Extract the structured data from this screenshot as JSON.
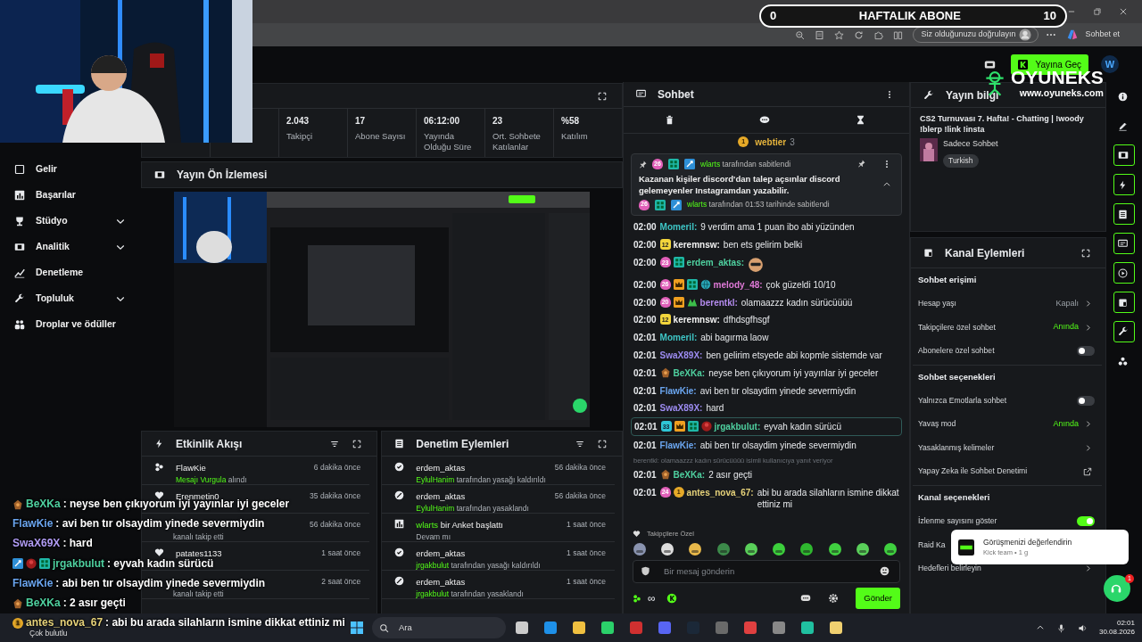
{
  "browser": {
    "verify_label": "Siz olduğunuzu doğrulayın",
    "copilot_label": "Sohbet et"
  },
  "goal_overlay": {
    "start": "0",
    "title": "HAFTALIK ABONE",
    "target": "10",
    "level": 0
  },
  "header": {
    "go_live": "Yayına Geç",
    "avatar": "W"
  },
  "logo_overlay": {
    "name": "OYUNEKS",
    "url": "www.oyuneks.com"
  },
  "sidebar": {
    "items": [
      {
        "label": "Gelir",
        "expandable": false
      },
      {
        "label": "Başarılar",
        "expandable": false
      },
      {
        "label": "Stüdyo",
        "expandable": true
      },
      {
        "label": "Analitik",
        "expandable": true
      },
      {
        "label": "Denetleme",
        "expandable": false
      },
      {
        "label": "Topluluk",
        "expandable": true
      },
      {
        "label": "Droplar ve ödüller",
        "expandable": false
      }
    ]
  },
  "stats": [
    {
      "value": "2.043",
      "label": "Takipçi"
    },
    {
      "value": "17",
      "label": "Abone Sayısı"
    },
    {
      "value": "06:12:00",
      "label": "Yayında Olduğu Süre"
    },
    {
      "value": "23",
      "label": "Ort. Sohbete Katılanlar"
    },
    {
      "value": "%58",
      "label": "Katılım"
    }
  ],
  "preview": {
    "title": "Yayın Ön İzlemesi"
  },
  "activity": {
    "title": "Etkinlik Akışı",
    "items": [
      {
        "kind": "highlight",
        "user": "FlawKie",
        "highlight": "Mesajı Vurgula",
        "detail": "alındı",
        "time": "6 dakika önce"
      },
      {
        "kind": "follow",
        "user": "Erenmetin0",
        "time": "35 dakika önce"
      },
      {
        "detail": "kanalı takip etti",
        "time": "56 dakika önce"
      },
      {
        "kind": "follow",
        "user": "patates1133",
        "time": "1 saat önce"
      },
      {
        "detail": "kanalı takip etti",
        "time": "2 saat önce"
      }
    ]
  },
  "moderation": {
    "title": "Denetim Eylemleri",
    "items": [
      {
        "kind": "unban",
        "user": "erdem_aktas",
        "actor": "EylulHanim",
        "detail": "tarafından yasağı kaldırıldı",
        "time": "56 dakika önce"
      },
      {
        "kind": "ban",
        "user": "erdem_aktas",
        "actor": "EylulHanim",
        "detail": "tarafından yasaklandı",
        "time": "56 dakika önce"
      },
      {
        "kind": "poll",
        "actor": "wlarts",
        "action": "bir Anket başlattı",
        "detail": "Devam mı",
        "time": "1 saat önce"
      },
      {
        "kind": "unban",
        "user": "erdem_aktas",
        "actor": "jrgakbulut",
        "detail": "tarafından yasağı kaldırıldı",
        "time": "1 saat önce"
      },
      {
        "kind": "ban",
        "user": "erdem_aktas",
        "actor": "jrgakbulut",
        "detail": "tarafından yasaklandı",
        "time": "1 saat önce"
      }
    ]
  },
  "chat": {
    "title": "Sohbet",
    "gift_banner": {
      "coin": "1",
      "user": "webtier",
      "count": "3"
    },
    "pinned": {
      "badges": [
        {
          "kind": "sub",
          "label": "26"
        },
        {
          "kind": "og"
        },
        {
          "kind": "mod"
        }
      ],
      "user": "wlarts",
      "header": "tarafından sabitlendi",
      "text": "Kazanan kişiler discord'dan talep açsınlar discord gelemeyenler Instagramdan yazabilir.",
      "footer_badges": [
        {
          "kind": "sub",
          "label": "26"
        },
        {
          "kind": "og"
        },
        {
          "kind": "mod"
        }
      ],
      "footer_user": "wlarts",
      "footer": "tarafından 01:53 tarihinde sabitlendi"
    },
    "messages": [
      {
        "kind": "message",
        "time": "02:00",
        "user": "Momeril:",
        "color": "#3ec6c6",
        "text": "9 verdim ama 1 puan ibo abi yüzünden",
        "highlighted": false
      },
      {
        "kind": "message",
        "time": "02:00",
        "badges": [
          {
            "kind": "sub-gold",
            "label": "12"
          }
        ],
        "user": "keremnsw:",
        "color": "#f2f2f2",
        "text": "ben ets gelirim belki",
        "highlighted": false
      },
      {
        "kind": "message",
        "time": "02:00",
        "badges": [
          {
            "kind": "sub",
            "label": "23"
          },
          {
            "kind": "og"
          }
        ],
        "user": "erdem_aktas:",
        "color": "#4fd1a0",
        "emote": true,
        "highlighted": false
      },
      {
        "kind": "message",
        "time": "02:00",
        "badges": [
          {
            "kind": "sub",
            "label": "26"
          },
          {
            "kind": "crown"
          },
          {
            "kind": "og"
          },
          {
            "kind": "globe"
          }
        ],
        "user": "melody_48:",
        "color": "#e07ad8",
        "text": "çok güzeldi 10/10",
        "highlighted": false
      },
      {
        "kind": "message",
        "time": "02:00",
        "badges": [
          {
            "kind": "sub",
            "label": "20"
          },
          {
            "kind": "crown"
          },
          {
            "kind": "m-logo"
          }
        ],
        "user": "berentkl:",
        "color": "#b58cf0",
        "text": "olamaazzz kadın sürücüüüü",
        "highlighted": false
      },
      {
        "kind": "message",
        "time": "02:00",
        "badges": [
          {
            "kind": "sub-gold",
            "label": "12"
          }
        ],
        "user": "keremnsw:",
        "color": "#f2f2f2",
        "text": "dfhdsgfhsgf",
        "highlighted": false
      },
      {
        "kind": "message",
        "time": "02:01",
        "user": "Momeril:",
        "color": "#3ec6c6",
        "text": "abi bagırma laow",
        "highlighted": false
      },
      {
        "kind": "message",
        "time": "02:01",
        "user": "SwaX89X:",
        "color": "#9d8cf2",
        "text": "ben gelirim etsyede abi kopmle sistemde var",
        "highlighted": false
      },
      {
        "kind": "message",
        "time": "02:01",
        "badges": [
          {
            "kind": "emblem"
          }
        ],
        "user": "BeXKa:",
        "color": "#4fd1a0",
        "text": "neyse ben çıkıyorum iyi yayınlar iyi geceler",
        "highlighted": false
      },
      {
        "kind": "message",
        "time": "02:01",
        "user": "FlawKie:",
        "color": "#6ba6f0",
        "text": "avi ben tır olsaydim yinede severmiydin",
        "highlighted": false
      },
      {
        "kind": "message",
        "time": "02:01",
        "user": "SwaX89X:",
        "color": "#9d8cf2",
        "text": "hard",
        "highlighted": false
      },
      {
        "kind": "message",
        "time": "02:01",
        "badges": [
          {
            "kind": "sub-teal",
            "label": "33"
          },
          {
            "kind": "crown"
          },
          {
            "kind": "og"
          },
          {
            "kind": "avatar"
          }
        ],
        "user": "jrgakbulut:",
        "color": "#4fd1a0",
        "text": "eyvah kadın sürücü",
        "highlighted": true
      },
      {
        "kind": "message",
        "time": "02:01",
        "user": "FlawKie:",
        "color": "#6ba6f0",
        "text": "abi ben tır olsaydim yinede severmiydin",
        "highlighted": false
      },
      {
        "kind": "reply",
        "text": "berentkl: olamaazzz kadın sürücüüüü isimli kullanıcıya yanıt veriyor"
      },
      {
        "kind": "message",
        "time": "02:01",
        "badges": [
          {
            "kind": "emblem"
          }
        ],
        "user": "BeXKa:",
        "color": "#4fd1a0",
        "text": "2 asır geçti",
        "highlighted": false
      },
      {
        "kind": "message",
        "time": "02:01",
        "badges": [
          {
            "kind": "sub",
            "label": "24"
          },
          {
            "kind": "coin",
            "label": "1"
          }
        ],
        "user": "antes_nova_67:",
        "color": "#e6d27a",
        "text": "abi bu arada silahların ismine dikkat ettiniz mi",
        "highlighted": false
      }
    ],
    "followers_label": "Takipçilere Özel",
    "input_placeholder": "Bir mesaj gönderin",
    "points": "∞",
    "send": "Gönder"
  },
  "stream_info": {
    "title": "Yayın bilgi",
    "stream_title": "CS2 Turnuvası 7. Hafta! - Chatting | !woody !blerp !link !insta",
    "category": "Sadece Sohbet",
    "tag": "Turkish"
  },
  "channel_actions": {
    "title": "Kanal Eylemleri",
    "sections": [
      {
        "heading": "Sohbet erişimi",
        "rows": [
          {
            "kind": "value",
            "label": "Hesap yaşı",
            "value": "Kapalı",
            "accent": false
          },
          {
            "kind": "value",
            "label": "Takipçilere özel sohbet",
            "value": "Anında",
            "accent": true
          },
          {
            "kind": "toggle",
            "label": "Abonelere özel sohbet",
            "on": false
          }
        ]
      },
      {
        "heading": "Sohbet seçenekleri",
        "rows": [
          {
            "kind": "toggle",
            "label": "Yalnızca Emotlarla sohbet",
            "on": false
          },
          {
            "kind": "value",
            "label": "Yavaş mod",
            "value": "Anında",
            "accent": true
          },
          {
            "kind": "link",
            "label": "Yasaklanmış kelimeler"
          },
          {
            "kind": "external",
            "label": "Yapay Zeka ile Sohbet Denetimi"
          }
        ]
      },
      {
        "heading": "Kanal seçenekleri",
        "rows": [
          {
            "kind": "toggle",
            "label": "İzlenme sayısını göster",
            "on": true
          },
          {
            "kind": "plain",
            "label": "Raid Ka"
          },
          {
            "kind": "link",
            "label": "Hedefleri belirleyin"
          }
        ]
      }
    ]
  },
  "rail": [
    {
      "active": false
    },
    {
      "active": false
    },
    {
      "active": true
    },
    {
      "active": true
    },
    {
      "active": true
    },
    {
      "active": true
    },
    {
      "active": true
    },
    {
      "active": true
    },
    {
      "active": true
    },
    {
      "active": false
    }
  ],
  "toast": {
    "title": "Görüşmenizi değerlendirin",
    "subtitle": "Kick team • 1 g"
  },
  "help": {
    "count": "1"
  },
  "chat_overlay": [
    {
      "badges": [
        {
          "kind": "emblem"
        }
      ],
      "user": "BeXKa",
      "color": "#4fd1a0",
      "text": ": neyse ben çıkıyorum iyi yayınlar iyi geceler"
    },
    {
      "user": "FlawKie",
      "color": "#6ba6f0",
      "text": ": avi ben tır olsaydim yinede severmiydin"
    },
    {
      "user": "SwaX69X",
      "color": "#b19cf5",
      "text": ": hard"
    },
    {
      "badges": [
        {
          "kind": "mod"
        },
        {
          "kind": "avatar"
        },
        {
          "kind": "og"
        }
      ],
      "user": "jrgakbulut",
      "color": "#4fd1a0",
      "text": ": eyvah kadın sürücü"
    },
    {
      "user": "FlawKie",
      "color": "#6ba6f0",
      "text": ": abi ben tır olsaydim yinede severmiydin"
    },
    {
      "badges": [
        {
          "kind": "emblem"
        }
      ],
      "user": "BeXKa",
      "color": "#4fd1a0",
      "text": ": 2 asır geçti"
    },
    {
      "badges": [
        {
          "kind": "coin",
          "label": "1"
        }
      ],
      "user": "antes_nova_67",
      "color": "#e6d27a",
      "text": ": abi bu arada silahların ismine dikkat ettiniz mi"
    }
  ],
  "taskbar": {
    "weather": "Çok bulutlu",
    "search": "Ara",
    "time": "02:01",
    "date": "30.08.2026"
  }
}
